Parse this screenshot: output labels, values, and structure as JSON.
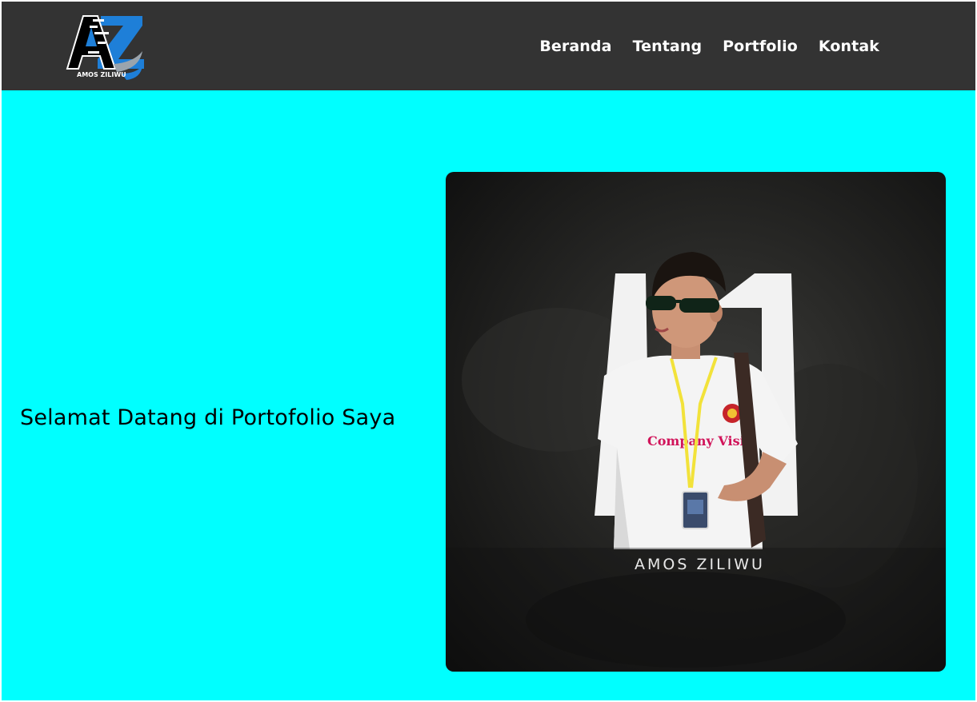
{
  "logo": {
    "text": "AMOS ZILIWU",
    "icon": "az-monogram-icon"
  },
  "nav": {
    "items": [
      {
        "label": "Beranda"
      },
      {
        "label": "Tentang"
      },
      {
        "label": "Portfolio"
      },
      {
        "label": "Kontak"
      }
    ]
  },
  "hero": {
    "title": "Selamat Datang di Portofolio Saya",
    "photo_caption": "AMOS ZILIWU",
    "photo_shirt_text": "Company Visit"
  },
  "colors": {
    "navbar": "#333333",
    "page_background": "#00ffff",
    "accent_blue": "#1e7fd8"
  }
}
